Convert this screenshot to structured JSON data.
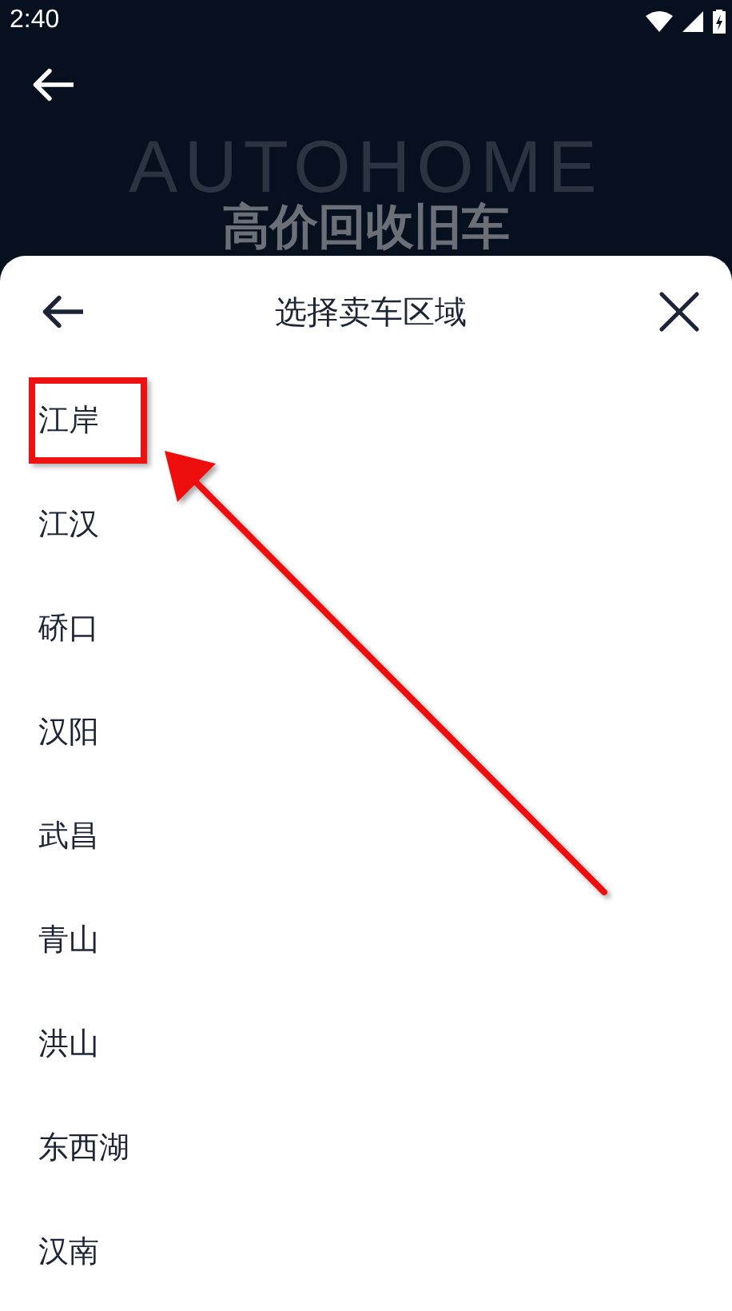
{
  "status_bar": {
    "time": "2:40"
  },
  "background": {
    "brand_text": "AUTOHOME",
    "headline": "高价回收旧车"
  },
  "sheet": {
    "title": "选择卖车区域",
    "items": [
      {
        "label": "江岸",
        "highlighted": true
      },
      {
        "label": "江汉",
        "highlighted": false
      },
      {
        "label": "硚口",
        "highlighted": false
      },
      {
        "label": "汉阳",
        "highlighted": false
      },
      {
        "label": "武昌",
        "highlighted": false
      },
      {
        "label": "青山",
        "highlighted": false
      },
      {
        "label": "洪山",
        "highlighted": false
      },
      {
        "label": "东西湖",
        "highlighted": false
      },
      {
        "label": "汉南",
        "highlighted": false
      }
    ]
  }
}
